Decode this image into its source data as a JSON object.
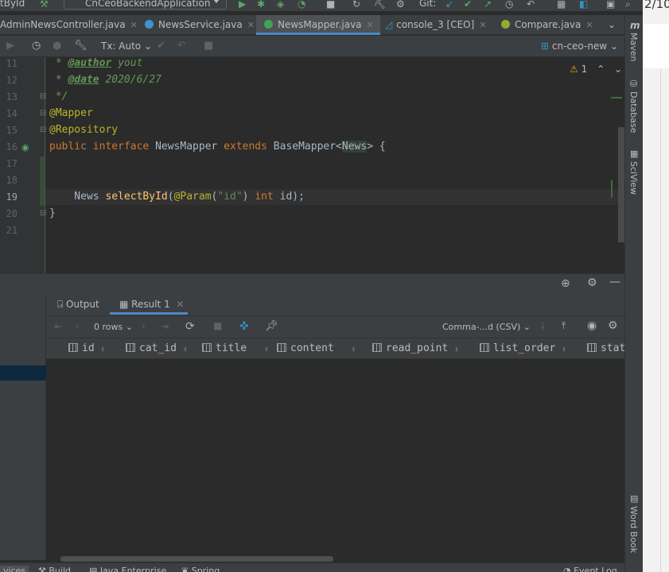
{
  "toolbar": {
    "left_text": "tById",
    "run_config": "CnCeoBackendApplication",
    "git_label": "Git:",
    "right_text": "2/10"
  },
  "tabs": [
    {
      "label": "AdminNewsController.java",
      "active": false
    },
    {
      "label": "NewsService.java",
      "active": false
    },
    {
      "label": "NewsMapper.java",
      "active": true
    },
    {
      "label": "console_3 [CEO]",
      "active": false
    },
    {
      "label": "Compare.java",
      "active": false
    }
  ],
  "db_toolbar": {
    "tx_mode": "Tx: Auto",
    "connection": "cn-ceo-new"
  },
  "editor": {
    "inspection_count": "1",
    "line_numbers": [
      "11",
      "12",
      "13",
      "14",
      "15",
      "16",
      "17",
      "18",
      "19",
      "20",
      "21"
    ],
    "lines": {
      "l11_star": " * ",
      "l11_tag": "@author",
      "l11_val": " yout",
      "l12_star": " * ",
      "l12_tag": "@date",
      "l12_val": " 2020/6/27",
      "l13": " */",
      "l14": "@Mapper",
      "l15": "@Repository",
      "l16_public": "public",
      "l16_interface": " interface",
      "l16_name": " NewsMapper ",
      "l16_extends": "extends",
      "l16_base": " BaseMapper<",
      "l16_gen": "News",
      "l16_end": "> {",
      "l19_type": "    News ",
      "l19_fn": "selectById",
      "l19_p1": "(",
      "l19_ann": "@Param",
      "l19_p2": "(",
      "l19_str": "\"id\"",
      "l19_p3": ") ",
      "l19_int": "int",
      "l19_end": " id);",
      "l20": "}"
    }
  },
  "right_strip": [
    "Maven",
    "Database",
    "SciView",
    "Word Book"
  ],
  "results": {
    "tabs": [
      "Output",
      "Result 1"
    ],
    "rows_label": "0 rows",
    "format": "Comma-...d (CSV)",
    "columns": [
      "id",
      "cat_id",
      "title",
      "content",
      "read_point",
      "list_order",
      "stat"
    ]
  },
  "bottom_bar": {
    "items": [
      "vices",
      "Build",
      "Java Enterprise",
      "Spring"
    ],
    "event_log": "Event Log"
  }
}
